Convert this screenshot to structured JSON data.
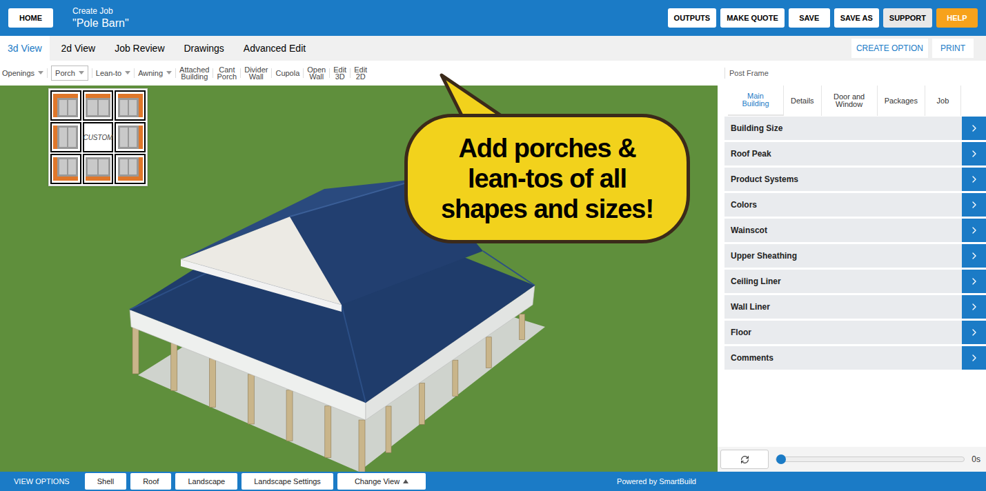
{
  "header": {
    "home": "HOME",
    "subtitle": "Create Job",
    "job_name": "\"Pole Barn\"",
    "buttons": [
      {
        "label": "OUTPUTS",
        "kind": "plain"
      },
      {
        "label": "MAKE QUOTE",
        "kind": "plain"
      },
      {
        "label": "SAVE",
        "kind": "plain"
      },
      {
        "label": "SAVE AS",
        "kind": "plain"
      },
      {
        "label": "SUPPORT",
        "kind": "support"
      },
      {
        "label": "HELP",
        "kind": "help"
      }
    ]
  },
  "view_tabs": [
    {
      "label": "3d View",
      "selected": true
    },
    {
      "label": "2d View",
      "selected": false
    },
    {
      "label": "Job Review",
      "selected": false
    },
    {
      "label": "Drawings",
      "selected": false
    },
    {
      "label": "Advanced Edit",
      "selected": false
    }
  ],
  "option_buttons": [
    "CREATE OPTION",
    "PRINT"
  ],
  "toolbar": {
    "items": [
      {
        "label": "Openings",
        "dropdown": true,
        "selected": false
      },
      {
        "label": "Porch",
        "dropdown": true,
        "selected": true
      },
      {
        "label": "Lean-to",
        "dropdown": true,
        "selected": false
      },
      {
        "label": "Awning",
        "dropdown": true,
        "selected": false
      },
      {
        "label": "Attached Building",
        "dropdown": false,
        "selected": false
      },
      {
        "label": "Cant Porch",
        "dropdown": false,
        "selected": false
      },
      {
        "label": "Divider Wall",
        "dropdown": false,
        "selected": false
      },
      {
        "label": "Cupola",
        "dropdown": false,
        "selected": false
      },
      {
        "label": "Open Wall",
        "dropdown": false,
        "selected": false
      },
      {
        "label": "Edit 3D",
        "dropdown": false,
        "selected": false
      },
      {
        "label": "Edit 2D",
        "dropdown": false,
        "selected": false
      }
    ],
    "context": "Post Frame"
  },
  "porch_menu": {
    "open": true,
    "options": [
      {
        "label": "",
        "sides": [
          "left",
          "top"
        ]
      },
      {
        "label": "",
        "sides": [
          "top"
        ]
      },
      {
        "label": "",
        "sides": [
          "top",
          "right"
        ]
      },
      {
        "label": "",
        "sides": [
          "left"
        ]
      },
      {
        "label": "CUSTOM",
        "sides": []
      },
      {
        "label": "",
        "sides": [
          "right"
        ]
      },
      {
        "label": "",
        "sides": [
          "left",
          "bottom"
        ]
      },
      {
        "label": "",
        "sides": [
          "bottom"
        ]
      },
      {
        "label": "",
        "sides": [
          "bottom",
          "right"
        ]
      }
    ]
  },
  "callout": {
    "text": "Add porches & lean-tos of all shapes and sizes!"
  },
  "side_tabs": [
    {
      "label": "Main Building",
      "selected": true
    },
    {
      "label": "Details",
      "selected": false
    },
    {
      "label": "Door and Window",
      "selected": false
    },
    {
      "label": "Packages",
      "selected": false
    },
    {
      "label": "Job",
      "selected": false
    }
  ],
  "sections": [
    "Building Size",
    "Roof Peak",
    "Product Systems",
    "Colors",
    "Wainscot",
    "Upper Sheathing",
    "Ceiling Liner",
    "Wall Liner",
    "Floor",
    "Comments"
  ],
  "playback": {
    "level": 0,
    "time": "0s"
  },
  "bottom_bar": {
    "label": "VIEW OPTIONS",
    "buttons": [
      "Shell",
      "Roof",
      "Landscape",
      "Landscape Settings"
    ],
    "change_view": "Change View",
    "credit": "Powered by SmartBuild"
  }
}
